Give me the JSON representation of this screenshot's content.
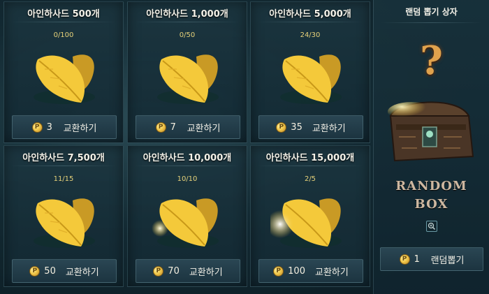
{
  "items": [
    {
      "title": "아인하사드 500개",
      "count": "0/100",
      "price": "3",
      "button_label": "교환하기"
    },
    {
      "title": "아인하사드 1,000개",
      "count": "0/50",
      "price": "7",
      "button_label": "교환하기"
    },
    {
      "title": "아인하사드 5,000개",
      "count": "24/30",
      "price": "35",
      "button_label": "교환하기"
    },
    {
      "title": "아인하사드 7,500개",
      "count": "11/15",
      "price": "50",
      "button_label": "교환하기"
    },
    {
      "title": "아인하사드 10,000개",
      "count": "10/10",
      "price": "70",
      "button_label": "교환하기"
    },
    {
      "title": "아인하사드 15,000개",
      "count": "2/5",
      "price": "100",
      "button_label": "교환하기"
    }
  ],
  "random_box": {
    "title": "랜덤 뽑기 상자",
    "question_mark": "?",
    "line1": "RANDOM",
    "line2": "BOX",
    "price": "1",
    "button_label": "랜덤뽑기"
  },
  "coin_symbol": "P",
  "colors": {
    "gold_text": "#e7d27a",
    "leaf_gold": "#f4c93a",
    "panel_bg": "#1c3440",
    "question_mark": "#e0a24d"
  },
  "icons": {
    "leaf": "golden-leaf-icon",
    "coin": "p-coin-icon",
    "zoom": "magnifier-zoom-icon",
    "chest": "treasure-chest-icon"
  }
}
